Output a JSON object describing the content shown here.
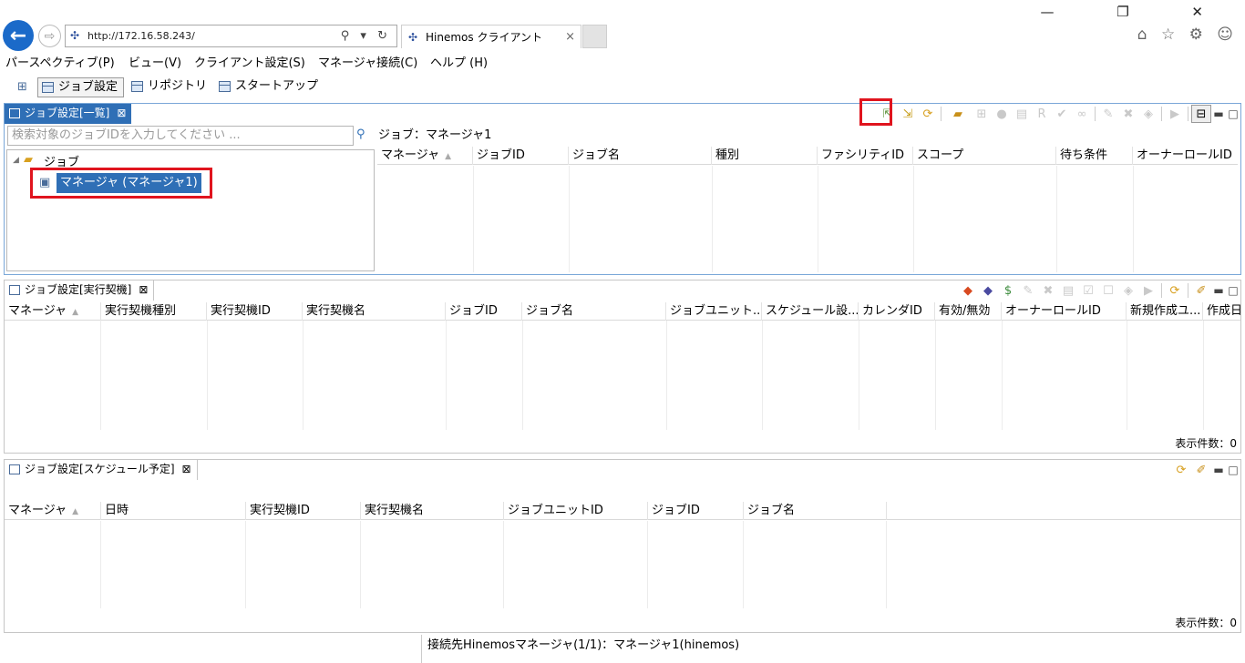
{
  "browser": {
    "url": "http://172.16.58.243/",
    "tab_title": "Hinemos クライアント",
    "tab_close": "×",
    "address_tools": "⚲ ▾ ↻",
    "window_controls": "—  ❐  ✕",
    "right_tools": "⌂ ☆ ⚙ ☺"
  },
  "menu": [
    "パースペクティブ(P)",
    "ビュー(V)",
    "クライアント設定(S)",
    "マネージャ接続(C)",
    "ヘルプ (H)"
  ],
  "perspectives": [
    {
      "label": "ジョブ設定"
    },
    {
      "label": "リポジトリ"
    },
    {
      "label": "スタートアップ"
    }
  ],
  "list_panel": {
    "tab_label": "ジョブ設定[一覧]",
    "search_placeholder": "検索対象のジョブIDを入力してください ...",
    "tree_root": "ジョブ",
    "tree_child": "マネージャ (マネージャ1)",
    "breadcrumb": "ジョブ：マネージャ1",
    "columns": [
      "マネージャ",
      "ジョブID",
      "ジョブ名",
      "種別",
      "ファシリティID",
      "スコープ",
      "待ち条件",
      "オーナーロールID"
    ]
  },
  "trigger_panel": {
    "tab_label": "ジョブ設定[実行契機]",
    "columns": [
      "マネージャ",
      "実行契機種別",
      "実行契機ID",
      "実行契機名",
      "ジョブID",
      "ジョブ名",
      "ジョブユニット...",
      "スケジュール設...",
      "カレンダID",
      "有効/無効",
      "オーナーロールID",
      "新規作成ユ...",
      "作成日"
    ],
    "count_text": "表示件数：0"
  },
  "schedule_panel": {
    "tab_label": "ジョブ設定[スケジュール予定]",
    "columns": [
      "マネージャ",
      "日時",
      "実行契機ID",
      "実行契機名",
      "ジョブユニットID",
      "ジョブID",
      "ジョブ名"
    ],
    "count_text": "表示件数：0"
  },
  "status_bar": "接続先Hinemosマネージャ(1/1)：マネージャ1(hinemos)",
  "colors": {
    "accent": "#2f6fb6",
    "highlight_box": "#e0141e"
  }
}
